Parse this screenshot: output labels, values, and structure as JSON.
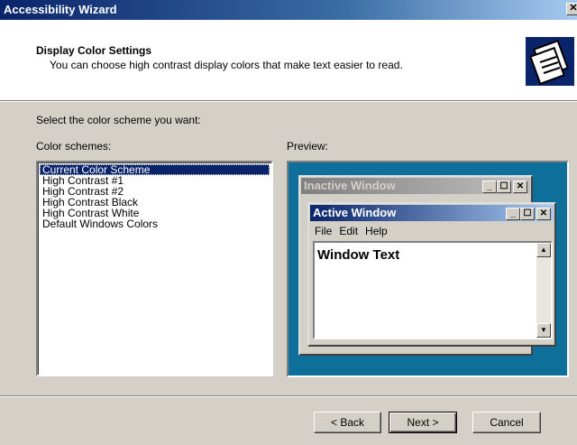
{
  "window": {
    "title": "Accessibility Wizard",
    "close_glyph": "✕"
  },
  "header": {
    "title": "Display Color Settings",
    "subtitle": "You can choose high contrast display colors that make text easier to read.",
    "icon": "accessibility-wizard-icon"
  },
  "main": {
    "prompt": "Select the color scheme you want:",
    "schemes_label": "Color schemes:",
    "preview_label": "Preview:",
    "schemes": [
      "Current Color Scheme",
      "High Contrast #1",
      "High Contrast #2",
      "High Contrast Black",
      "High Contrast White",
      "Default Windows Colors"
    ],
    "selected_index": 0
  },
  "preview": {
    "inactive_title": "Inactive Window",
    "active_title": "Active Window",
    "menu": [
      "File",
      "Edit",
      "Help"
    ],
    "window_text": "Window Text",
    "min_glyph": "_",
    "max_glyph": "☐",
    "close_glyph": "✕",
    "scroll_up": "▲",
    "scroll_down": "▼"
  },
  "buttons": {
    "back": "< Back",
    "next": "Next >",
    "cancel": "Cancel"
  },
  "colors": {
    "desktop": "#0e6f9a",
    "selection": "#0a246a",
    "face": "#d4d0c8"
  }
}
